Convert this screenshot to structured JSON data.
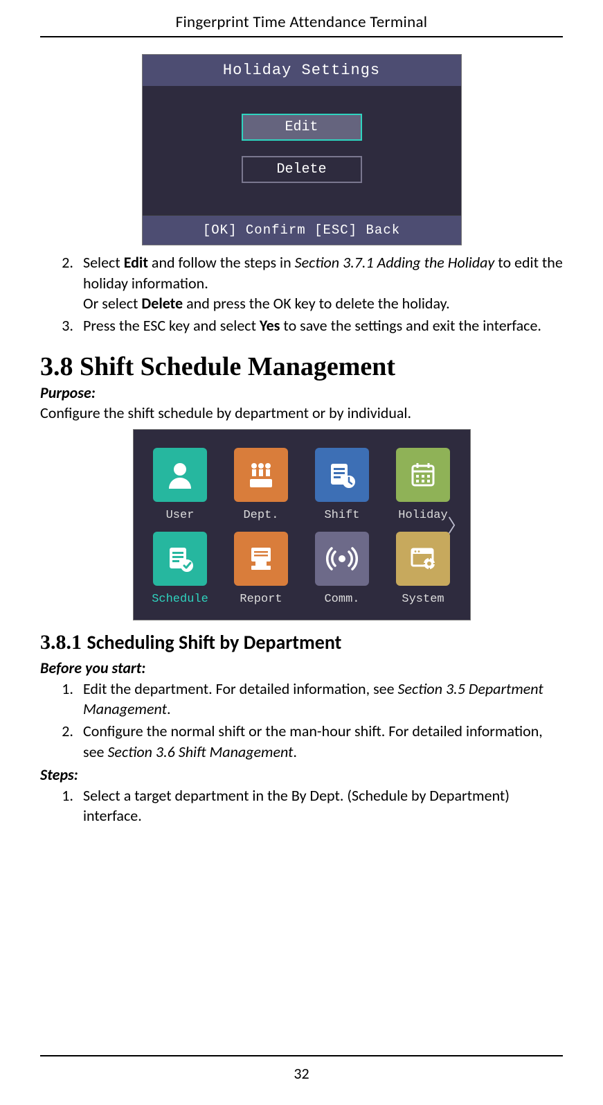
{
  "header": "Fingerprint Time Attendance Terminal",
  "page_number": "32",
  "shot1": {
    "title": "Holiday Settings",
    "edit": "Edit",
    "delete": "Delete",
    "footer": "[OK] Confirm   [ESC] Back"
  },
  "list1": {
    "n2": "2.",
    "n3": "3.",
    "t2a": "Select ",
    "t2b": "Edit",
    "t2c": " and follow the steps in ",
    "t2d": "Section 3.7.1 Adding the Holiday",
    "t2e": " to edit the holiday information.",
    "t2f": "Or select ",
    "t2g": "Delete",
    "t2h": " and press the OK key to delete the holiday.",
    "t3a": "Press the ESC key and select ",
    "t3b": "Yes",
    "t3c": " to save the settings and exit the interface."
  },
  "sec38": {
    "title": "3.8   Shift Schedule Management",
    "purpose_lbl": "Purpose:",
    "purpose_txt": "Configure the shift schedule by department or by individual."
  },
  "menu": {
    "items": [
      {
        "label": "User"
      },
      {
        "label": "Dept."
      },
      {
        "label": "Shift"
      },
      {
        "label": "Holiday"
      },
      {
        "label": "Schedule"
      },
      {
        "label": "Report"
      },
      {
        "label": "Comm."
      },
      {
        "label": "System"
      }
    ],
    "chevron": "〉"
  },
  "sec381": {
    "num": "3.8.1",
    "title": "Scheduling Shift by Department",
    "before_lbl": "Before you start:",
    "b1n": "1.",
    "b1a": "Edit the department. For detailed information, see ",
    "b1b": "Section 3.5 Department Management",
    "b1c": ".",
    "b2n": "2.",
    "b2a": "Configure the normal shift or the man-hour shift. For detailed information, see ",
    "b2b": "Section 3.6 Shift Management",
    "b2c": ".",
    "steps_lbl": "Steps:",
    "s1n": "1.",
    "s1t": "Select a target department in the By Dept. (Schedule by Department) interface."
  }
}
